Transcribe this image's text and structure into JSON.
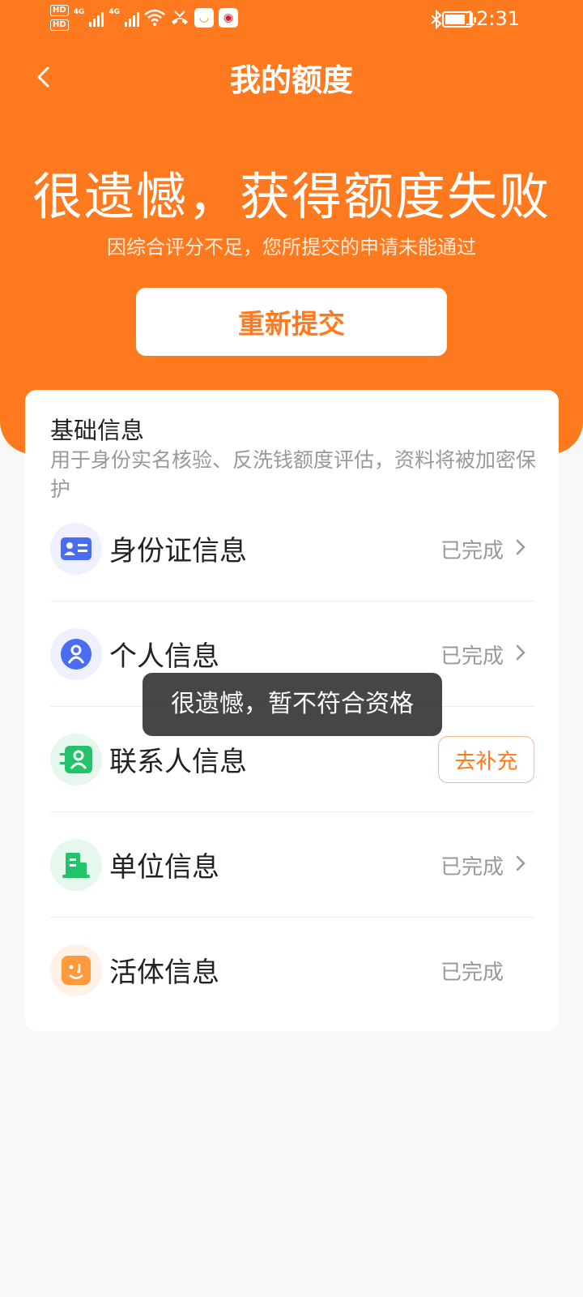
{
  "status_bar": {
    "hd1": "HD",
    "hd2": "HD",
    "sim1_tag": "4G",
    "sim2_tag": "4G",
    "time": "12:31",
    "battery_level": 0.8
  },
  "header": {
    "title": "我的额度"
  },
  "result": {
    "title": "很遗憾，获得额度失败",
    "subtitle": "因综合评分不足，您所提交的申请未能通过",
    "button_label": "重新提交"
  },
  "basic_info": {
    "title": "基础信息",
    "description": "用于身份实名核验、反洗钱额度评估，资料将被加密保护",
    "items": [
      {
        "label": "身份证信息",
        "status": "已完成",
        "icon": "id-card-icon",
        "icon_bg": "#eef1fd",
        "icon_color": "#4a6cf0"
      },
      {
        "label": "个人信息",
        "status": "已完成",
        "icon": "person-icon",
        "icon_bg": "#eef1fd",
        "icon_color": "#4a6cf0"
      },
      {
        "label": "联系人信息",
        "action": "去补充",
        "icon": "contacts-icon",
        "icon_bg": "#e6f8ee",
        "icon_color": "#22c36a"
      },
      {
        "label": "单位信息",
        "status": "已完成",
        "icon": "building-icon",
        "icon_bg": "#e6f8ee",
        "icon_color": "#22c36a"
      },
      {
        "label": "活体信息",
        "status": "已完成",
        "icon": "face-icon",
        "icon_bg": "#fff1e6",
        "icon_color": "#ff9a3c"
      }
    ]
  },
  "toast": {
    "message": "很遗憾，暂不符合资格"
  },
  "colors": {
    "brand": "#ff7a1f",
    "background": "#f8f8f8"
  }
}
